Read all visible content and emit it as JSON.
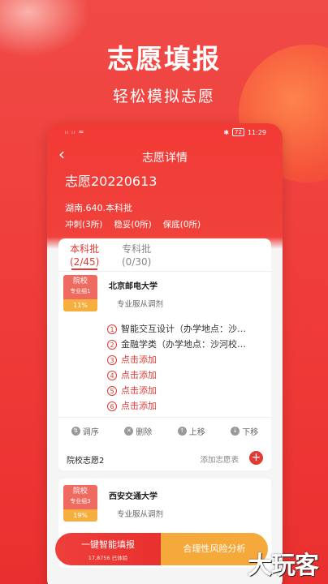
{
  "promo": {
    "headline": "志愿填报",
    "subline": "轻松模拟志愿"
  },
  "statusbar": {
    "left": "ᵢₗ ᵢₗ ≈",
    "battery": "72",
    "time": "11:29"
  },
  "nav": {
    "back_icon": "chevron-left-icon",
    "title": "志愿详情"
  },
  "plan": {
    "name": "志愿20220613",
    "meta": "湖南.640.本科批",
    "counts": [
      "冲刺(3所)",
      "稳妥(0所)",
      "保底(0所)"
    ]
  },
  "tabs": [
    {
      "label": "本科批",
      "count": "(2/45)",
      "active": true
    },
    {
      "label": "专科批",
      "count": "(0/30)",
      "active": false
    }
  ],
  "school1": {
    "badge_top": "院校",
    "badge_sub": "专业组1",
    "pct": "11%",
    "name": "北京邮电大学",
    "adjust": "专业服从调剂",
    "majors": [
      {
        "num": "1",
        "text": "智能交互设计（办学地点：沙…"
      },
      {
        "num": "2",
        "text": "金融学类（办学地点：沙河校…"
      },
      {
        "num": "3",
        "text": "点击添加"
      },
      {
        "num": "4",
        "text": "点击添加"
      },
      {
        "num": "5",
        "text": "点击添加"
      },
      {
        "num": "6",
        "text": "点击添加"
      }
    ]
  },
  "actions": [
    {
      "icon": "sort-icon",
      "label": "调序"
    },
    {
      "icon": "trash-icon",
      "label": "删除"
    },
    {
      "icon": "arrow-up-icon",
      "label": "上移"
    },
    {
      "icon": "arrow-down-icon",
      "label": "下移"
    }
  ],
  "school2_row": {
    "label": "院校志愿2",
    "add_label": "添加志愿表"
  },
  "school2": {
    "badge_top": "院校",
    "badge_sub": "专业组3",
    "pct": "19%",
    "name": "西安交通大学",
    "adjust": "专业服从调剂"
  },
  "bottom": {
    "primary_label": "一键智能填报",
    "primary_sub": "17,8756 已体验",
    "secondary_label": "合理性风险分析"
  },
  "watermark": "大玩客",
  "colors": {
    "brand_red": "#ef3b39",
    "accent_orange": "#f6a93b"
  }
}
